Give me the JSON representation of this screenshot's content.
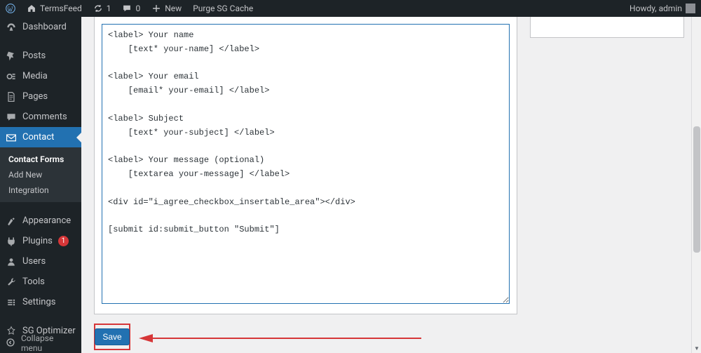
{
  "adminBar": {
    "siteName": "TermsFeed",
    "updatesCount": "1",
    "commentsCount": "0",
    "newLabel": "New",
    "purgeCache": "Purge SG Cache",
    "howdy": "Howdy, admin"
  },
  "sidebar": {
    "items": [
      {
        "icon": "dashboard-icon",
        "label": "Dashboard"
      },
      {
        "icon": "pin-icon",
        "label": "Posts"
      },
      {
        "icon": "media-icon",
        "label": "Media"
      },
      {
        "icon": "page-icon",
        "label": "Pages"
      },
      {
        "icon": "comment-icon",
        "label": "Comments"
      },
      {
        "icon": "mail-icon",
        "label": "Contact",
        "selected": true
      },
      {
        "icon": "appearance-icon",
        "label": "Appearance"
      },
      {
        "icon": "plugin-icon",
        "label": "Plugins",
        "badge": "1"
      },
      {
        "icon": "user-icon",
        "label": "Users"
      },
      {
        "icon": "tools-icon",
        "label": "Tools"
      },
      {
        "icon": "settings-icon",
        "label": "Settings"
      },
      {
        "icon": "sg-icon",
        "label": "SG Optimizer"
      }
    ],
    "submenu": {
      "items": [
        {
          "label": "Contact Forms",
          "selected": true
        },
        {
          "label": "Add New"
        },
        {
          "label": "Integration"
        }
      ]
    },
    "collapse": "Collapse menu"
  },
  "editor": {
    "content": "<label> Your name\n    [text* your-name] </label>\n\n<label> Your email\n    [email* your-email] </label>\n\n<label> Subject\n    [text* your-subject] </label>\n\n<label> Your message (optional)\n    [textarea your-message] </label>\n\n<div id=\"i_agree_checkbox_insertable_area\"></div>\n\n[submit id:submit_button \"Submit\"]"
  },
  "buttons": {
    "save": "Save"
  }
}
